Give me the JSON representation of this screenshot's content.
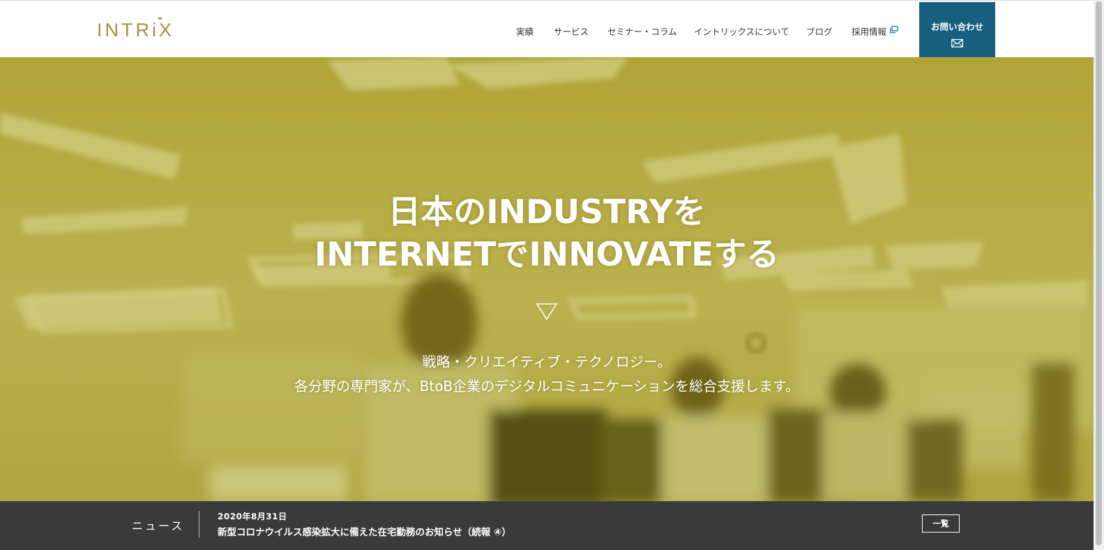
{
  "header": {
    "logo": "INTRiX",
    "nav": {
      "works": "実績",
      "services": "サービス",
      "seminar_column": "セミナー・コラム",
      "about": "イントリックスについて",
      "blog": "ブログ",
      "recruit": "採用情報"
    },
    "contact_label": "お問い合わせ"
  },
  "hero": {
    "headline_line1": "日本のINDUSTRYを",
    "headline_line2": "INTERNETでINNOVATEする",
    "sub_line1": "戦略・クリエイティブ・テクノロジー。",
    "sub_line2": "各分野の専門家が、BtoB企業のデジタルコミュニケーションを総合支援します。"
  },
  "news": {
    "label": "ニュース",
    "date": "2020年8月31日",
    "title": "新型コロナウイルス感染拡大に備えた在宅勤務のお知らせ（続報 ④）",
    "list_button": "一覧"
  },
  "colors": {
    "brand_gold": "#a39142",
    "contact_blue": "#165f7e",
    "hero_tint": "#b1a849",
    "newsbar_bg": "#3a3a3a"
  },
  "icons": {
    "external_link": "external-link-icon",
    "mail": "mail-icon",
    "scroll_down": "triangle-down-icon"
  }
}
